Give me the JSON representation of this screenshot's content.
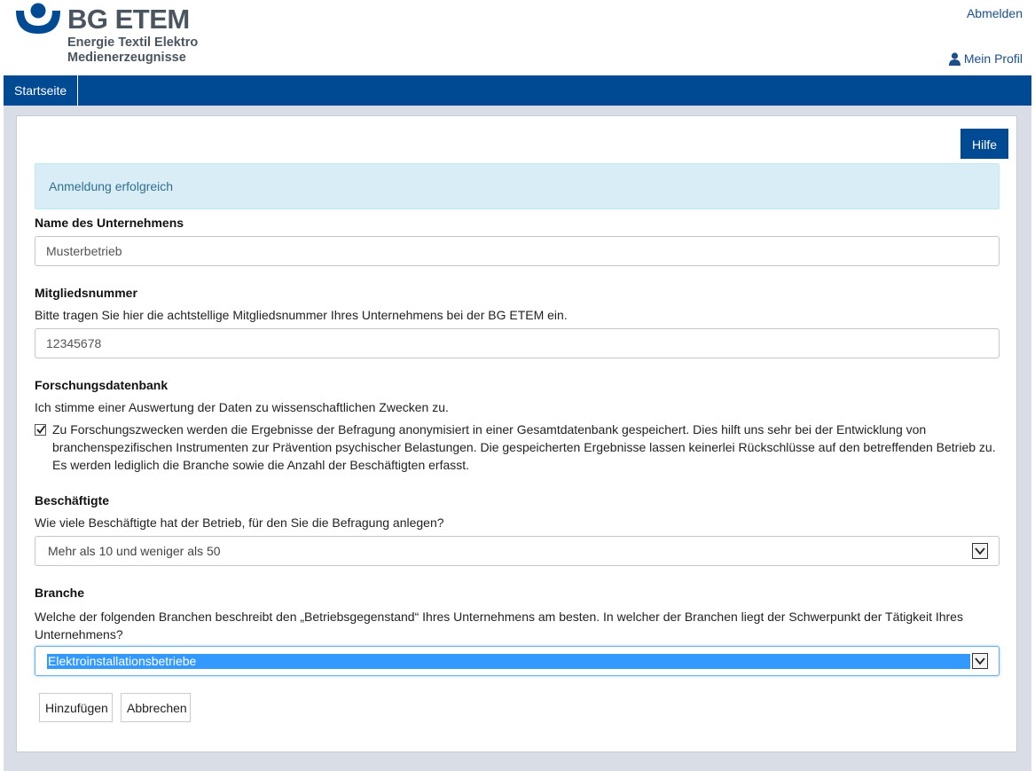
{
  "brand": {
    "title": "BG ETEM",
    "subtitle_line1": "Energie Textil Elektro",
    "subtitle_line2": "Medienerzeugnisse",
    "color": "#004a93"
  },
  "header": {
    "logout_label": "Abmelden",
    "profile_label": "Mein Profil",
    "profile_icon": "user-icon"
  },
  "nav": {
    "items": [
      {
        "label": "Startseite"
      }
    ]
  },
  "help_button_label": "Hilfe",
  "alert": {
    "text": "Anmeldung erfolgreich"
  },
  "form": {
    "company": {
      "label": "Name des Unternehmens",
      "value": "Musterbetrieb"
    },
    "member": {
      "label": "Mitgliedsnummer",
      "help": "Bitte tragen Sie hier die achtstellige Mitgliedsnummer Ihres Unternehmens bei der BG ETEM ein.",
      "value": "12345678"
    },
    "research": {
      "label": "Forschungsdatenbank",
      "help": "Ich stimme einer Auswertung der Daten zu wissenschaftlichen Zwecken zu.",
      "checked": true,
      "checkbox_text": "Zu Forschungszwecken werden die Ergebnisse der Befragung anonymisiert in einer Gesamtdatenbank gespeichert. Dies hilft uns sehr bei der Entwicklung von branchenspezifischen Instrumenten zur Prävention psychischer Belastungen. Die gespeicherten Ergebnisse lassen keinerlei Rückschlüsse auf den betreffenden Betrieb zu. Es werden lediglich die Branche sowie die Anzahl der Beschäftigten erfasst."
    },
    "employees": {
      "label": "Beschäftigte",
      "help": "Wie viele Beschäftigte hat der Betrieb, für den Sie die Befragung anlegen?",
      "selected": "Mehr als 10 und weniger als 50"
    },
    "industry": {
      "label": "Branche",
      "help": "Welche der folgenden Branchen beschreibt den „Betriebsgegenstand“ Ihres Unternehmens am besten. In welcher der Branchen liegt der Schwerpunkt der Tätigkeit Ihres Unternehmens?",
      "selected": "Elektroinstallationsbetriebe"
    }
  },
  "actions": {
    "add_label": "Hinzufügen",
    "cancel_label": "Abbrechen"
  }
}
